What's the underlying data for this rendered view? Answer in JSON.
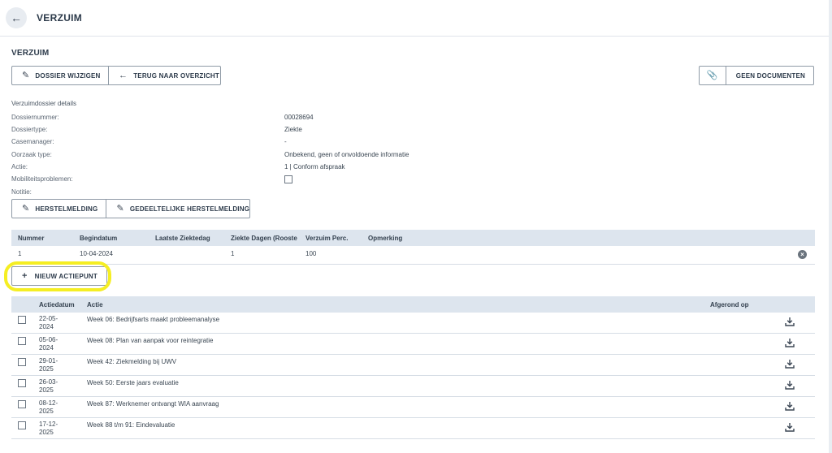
{
  "header": {
    "back_icon": "arrow-left-icon",
    "title": "VERZUIM"
  },
  "section_title": "VERZUIM",
  "toolbar": {
    "edit_label": "DOSSIER WIJZIGEN",
    "back_label": "TERUG NAAR OVERZICHT",
    "documents_label": "GEEN DOCUMENTEN"
  },
  "details": {
    "header": "Verzuimdossier details",
    "rows": [
      {
        "label": "Dossiernummer:",
        "value": "00028694"
      },
      {
        "label": "Dossiertype:",
        "value": "Ziekte"
      },
      {
        "label": "Casemanager:",
        "value": "-"
      },
      {
        "label": "Oorzaak type:",
        "value": "Onbekend, geen of onvoldoende informatie"
      },
      {
        "label": "Actie:",
        "value": "1 | Conform afspraak"
      },
      {
        "label": "Mobiliteitsproblemen:",
        "value": ""
      },
      {
        "label": "Notitie:",
        "value": ""
      }
    ]
  },
  "recovery": {
    "herstel_label": "HERSTELMELDING",
    "gedeeltelijk_label": "GEDEELTELIJKE HERSTELMELDING"
  },
  "sick_table": {
    "columns": [
      "Nummer",
      "Begindatum",
      "Laatste Ziektedag",
      "Ziekte Dagen (Rooste",
      "Verzuim Perc.",
      "Opmerking"
    ],
    "rows": [
      {
        "nummer": "1",
        "begindatum": "10-04-2024",
        "laatste": "",
        "dagen": "1",
        "perc": "100",
        "opmerking": ""
      }
    ]
  },
  "new_action_label": "NIEUW ACTIEPUNT",
  "highlight_color": "#f5ee23",
  "actions_table": {
    "columns": [
      "Actiedatum",
      "Actie",
      "Afgerond op"
    ],
    "rows": [
      {
        "date_line1": "22-05-",
        "date_line2": "2024",
        "action": "Week 06: Bedrijfsarts maakt probleemanalyse",
        "done": ""
      },
      {
        "date_line1": "05-06-",
        "date_line2": "2024",
        "action": "Week 08: Plan van aanpak voor reintegratie",
        "done": ""
      },
      {
        "date_line1": "29-01-",
        "date_line2": "2025",
        "action": "Week 42: Ziekmelding bij UWV",
        "done": ""
      },
      {
        "date_line1": "26-03-",
        "date_line2": "2025",
        "action": "Week 50: Eerste jaars evaluatie",
        "done": ""
      },
      {
        "date_line1": "08-12-",
        "date_line2": "2025",
        "action": "Week 87: Werknemer ontvangt WIA aanvraag",
        "done": ""
      },
      {
        "date_line1": "17-12-",
        "date_line2": "2025",
        "action": "Week 88 t/m 91: Eindevaluatie",
        "done": ""
      }
    ]
  }
}
